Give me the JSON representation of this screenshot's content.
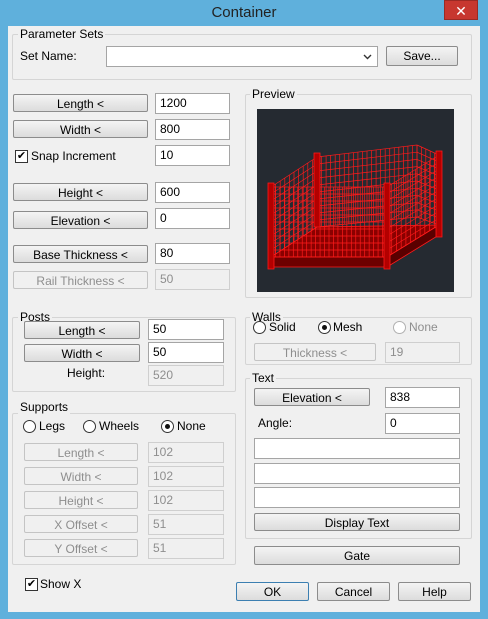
{
  "window": {
    "title": "Container",
    "close_glyph": "✕"
  },
  "parameter_sets": {
    "group_label": "Parameter Sets",
    "set_name_label": "Set Name:",
    "set_name_value": "",
    "save_label": "Save..."
  },
  "dimensions": {
    "length_label": "Length <",
    "length_value": "1200",
    "width_label": "Width <",
    "width_value": "800",
    "snap_label": "Snap Increment",
    "snap_checked": true,
    "snap_value": "10",
    "height_label": "Height <",
    "height_value": "600",
    "elevation_label": "Elevation <",
    "elevation_value": "0",
    "base_thickness_label": "Base Thickness <",
    "base_thickness_value": "80",
    "rail_thickness_label": "Rail Thickness <",
    "rail_thickness_value": "50"
  },
  "preview": {
    "group_label": "Preview",
    "mesh_color": "#ff1a1a",
    "background": "#252a31"
  },
  "posts": {
    "group_label": "Posts",
    "length_label": "Length <",
    "length_value": "50",
    "width_label": "Width <",
    "width_value": "50",
    "height_label": "Height:",
    "height_value": "520"
  },
  "walls": {
    "group_label": "Walls",
    "solid_label": "Solid",
    "mesh_label": "Mesh",
    "none_label": "None",
    "selected": "Mesh",
    "thickness_label": "Thickness <",
    "thickness_value": "19"
  },
  "supports": {
    "group_label": "Supports",
    "legs_label": "Legs",
    "wheels_label": "Wheels",
    "none_label": "None",
    "selected": "None",
    "length_label": "Length <",
    "length_value": "102",
    "width_label": "Width <",
    "width_value": "102",
    "height_label": "Height <",
    "height_value": "102",
    "x_offset_label": "X Offset <",
    "x_offset_value": "51",
    "y_offset_label": "Y Offset <",
    "y_offset_value": "51"
  },
  "text": {
    "group_label": "Text",
    "elevation_label": "Elevation <",
    "elevation_value": "838",
    "angle_label": "Angle:",
    "angle_value": "0",
    "line1": "",
    "line2": "",
    "line3": "",
    "display_text_label": "Display Text"
  },
  "gate_label": "Gate",
  "show_x": {
    "label": "Show X",
    "checked": true
  },
  "footer": {
    "ok_label": "OK",
    "cancel_label": "Cancel",
    "help_label": "Help"
  },
  "icons": {
    "dropdown": "chevron-down-icon",
    "check": "checkmark-icon"
  },
  "colors": {
    "title_bar": "#5fb0dc",
    "close_button": "#c7372f",
    "dialog_bg": "#f0f0f0"
  }
}
